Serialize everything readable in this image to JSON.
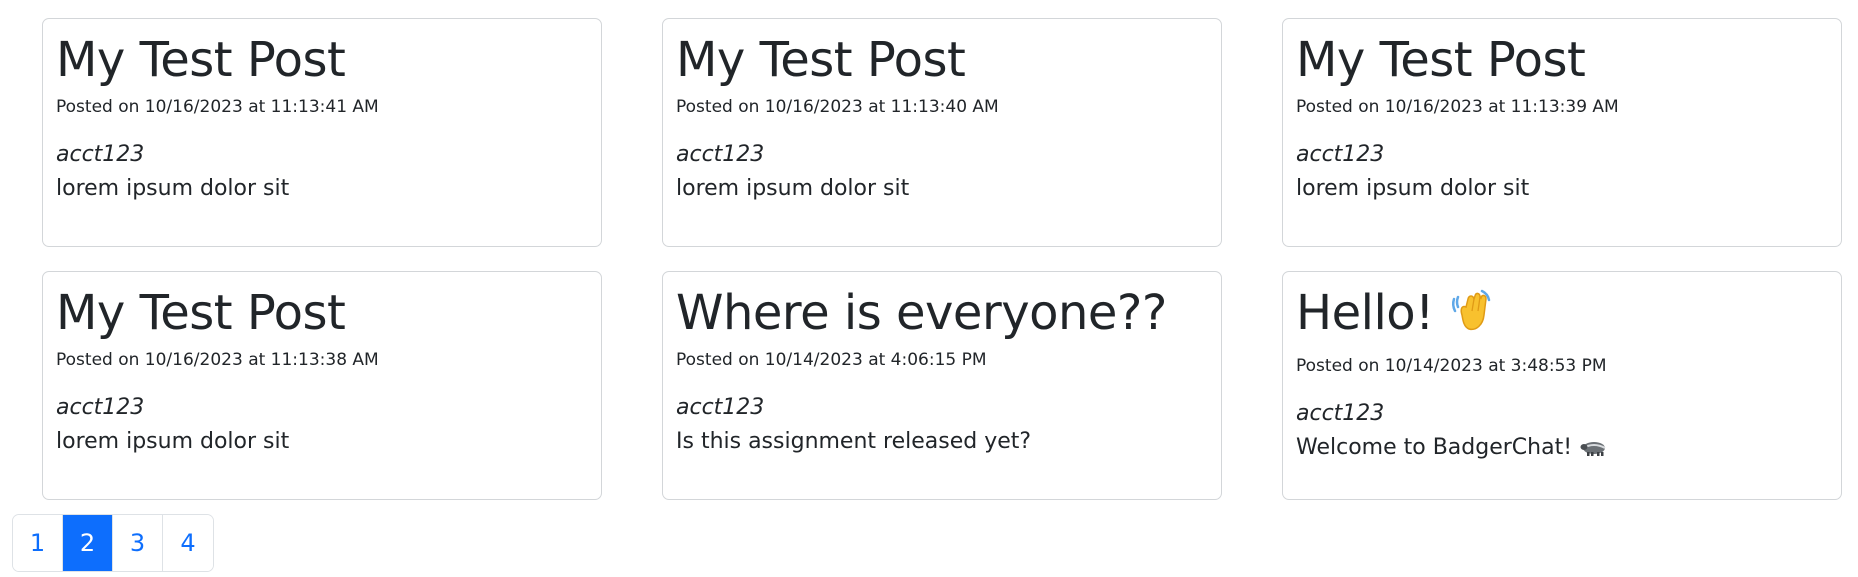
{
  "posts": [
    {
      "title": "My Test Post",
      "date": "Posted on 10/16/2023 at 11:13:41 AM",
      "author": "acct123",
      "body": "lorem ipsum dolor sit"
    },
    {
      "title": "My Test Post",
      "date": "Posted on 10/16/2023 at 11:13:40 AM",
      "author": "acct123",
      "body": "lorem ipsum dolor sit"
    },
    {
      "title": "My Test Post",
      "date": "Posted on 10/16/2023 at 11:13:39 AM",
      "author": "acct123",
      "body": "lorem ipsum dolor sit"
    },
    {
      "title": "My Test Post",
      "date": "Posted on 10/16/2023 at 11:13:38 AM",
      "author": "acct123",
      "body": "lorem ipsum dolor sit"
    },
    {
      "title": "Where is everyone??",
      "date": "Posted on 10/14/2023 at 4:06:15 PM",
      "author": "acct123",
      "body": "Is this assignment released yet?"
    },
    {
      "title": "Hello!",
      "title_icon": "waving-hand-icon",
      "date": "Posted on 10/14/2023 at 3:48:53 PM",
      "author": "acct123",
      "body": "Welcome to BadgerChat!",
      "body_icon": "badger-icon"
    }
  ],
  "pagination": {
    "pages": [
      "1",
      "2",
      "3",
      "4"
    ],
    "active_page": "2",
    "active_color": "#0d6efd",
    "link_color": "#0d6efd"
  }
}
